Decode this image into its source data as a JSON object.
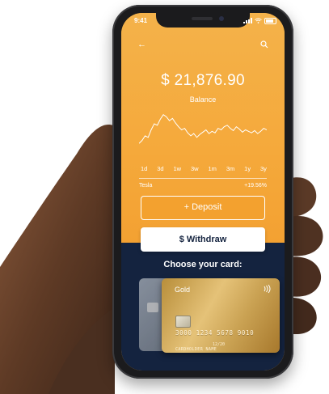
{
  "status_bar": {
    "time": "9:41"
  },
  "balance": {
    "amount": "$ 21,876.90",
    "label": "Balance"
  },
  "chart_data": {
    "type": "line",
    "title": "",
    "xlabel": "",
    "ylabel": "",
    "series": [
      {
        "values": [
          20,
          24,
          30,
          28,
          38,
          46,
          44,
          52,
          58,
          55,
          50,
          53,
          47,
          42,
          38,
          40,
          34,
          30,
          33,
          28,
          32,
          35,
          38,
          33,
          36,
          34,
          40,
          38,
          42,
          44,
          40,
          37,
          42,
          39,
          35,
          38,
          36,
          34,
          37,
          33,
          36,
          40,
          38
        ]
      }
    ],
    "ylim": [
      0,
      62
    ],
    "grid": false,
    "color": "#ffffff"
  },
  "ranges": [
    "1d",
    "3d",
    "1w",
    "3w",
    "1m",
    "3m",
    "1y",
    "3y"
  ],
  "stock": {
    "name": "Tesla",
    "change": "+19.56%"
  },
  "buttons": {
    "deposit": "+ Deposit",
    "withdraw": "$ Withdraw"
  },
  "cards_section": {
    "title": "Choose your card:"
  },
  "card": {
    "name": "Gold",
    "number": "3000 1234 5678 9010",
    "expiry": "12/20",
    "holder": "CARDHOLDER NAME"
  },
  "colors": {
    "accent": "#F5A93A",
    "dark": "#14233F",
    "white": "#FFFFFF"
  }
}
